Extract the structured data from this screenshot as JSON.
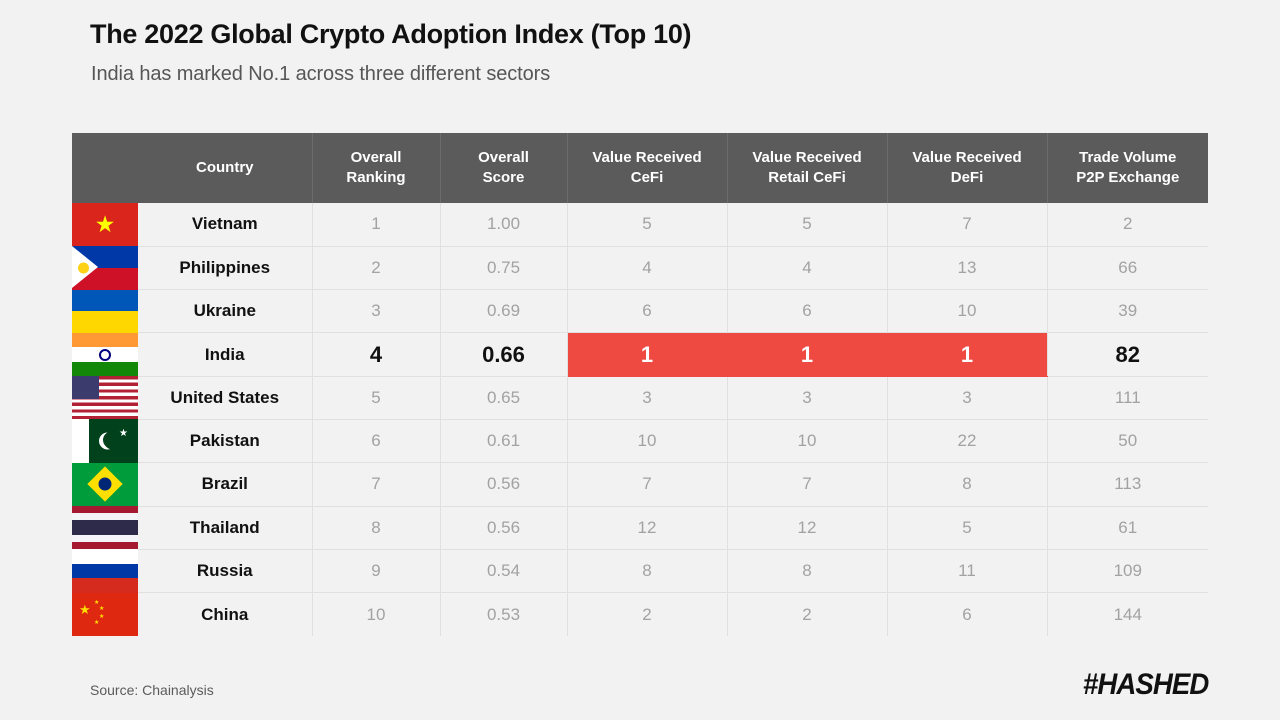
{
  "title": "The 2022 Global Crypto Adoption Index (Top 10)",
  "subtitle": "India has marked No.1 across three different sectors",
  "source": "Source: Chainalysis",
  "logo": "#HASHED",
  "colors": {
    "background": "#f2f2f2",
    "header_bg": "#5b5b5b",
    "highlight_red": "#ef4a42",
    "cell_bg": "#f2f2f2",
    "muted_text": "#a2a2a2",
    "dark_text": "#111111"
  },
  "chart_data": {
    "type": "table",
    "title": "The 2022 Global Crypto Adoption Index (Top 10)",
    "subtitle": "India has marked No.1 across three different sectors",
    "columns": [
      "Country",
      "Overall Ranking",
      "Overall Score",
      "Value Received CeFi",
      "Value Received Retail CeFi",
      "Value Received DeFi",
      "Trade Volume P2P Exchange"
    ],
    "column_headers": [
      {
        "line1": "Country",
        "line2": ""
      },
      {
        "line1": "Overall",
        "line2": "Ranking"
      },
      {
        "line1": "Overall",
        "line2": "Score"
      },
      {
        "line1": "Value Received",
        "line2": "CeFi"
      },
      {
        "line1": "Value Received",
        "line2": "Retail CeFi"
      },
      {
        "line1": "Value Received",
        "line2": "DeFi"
      },
      {
        "line1": "Trade Volume",
        "line2": "P2P Exchange"
      }
    ],
    "rows": [
      {
        "flag": "vn",
        "country": "Vietnam",
        "ranking": "1",
        "score": "1.00",
        "cefi": "5",
        "retail_cefi": "5",
        "defi": "7",
        "p2p": "2",
        "highlight": false
      },
      {
        "flag": "ph",
        "country": "Philippines",
        "ranking": "2",
        "score": "0.75",
        "cefi": "4",
        "retail_cefi": "4",
        "defi": "13",
        "p2p": "66",
        "highlight": false
      },
      {
        "flag": "ua",
        "country": "Ukraine",
        "ranking": "3",
        "score": "0.69",
        "cefi": "6",
        "retail_cefi": "6",
        "defi": "10",
        "p2p": "39",
        "highlight": false
      },
      {
        "flag": "in",
        "country": "India",
        "ranking": "4",
        "score": "0.66",
        "cefi": "1",
        "retail_cefi": "1",
        "defi": "1",
        "p2p": "82",
        "highlight": true
      },
      {
        "flag": "us",
        "country": "United States",
        "ranking": "5",
        "score": "0.65",
        "cefi": "3",
        "retail_cefi": "3",
        "defi": "3",
        "p2p": "111",
        "highlight": false
      },
      {
        "flag": "pk",
        "country": "Pakistan",
        "ranking": "6",
        "score": "0.61",
        "cefi": "10",
        "retail_cefi": "10",
        "defi": "22",
        "p2p": "50",
        "highlight": false
      },
      {
        "flag": "br",
        "country": "Brazil",
        "ranking": "7",
        "score": "0.56",
        "cefi": "7",
        "retail_cefi": "7",
        "defi": "8",
        "p2p": "113",
        "highlight": false
      },
      {
        "flag": "th",
        "country": "Thailand",
        "ranking": "8",
        "score": "0.56",
        "cefi": "12",
        "retail_cefi": "12",
        "defi": "5",
        "p2p": "61",
        "highlight": false
      },
      {
        "flag": "ru",
        "country": "Russia",
        "ranking": "9",
        "score": "0.54",
        "cefi": "8",
        "retail_cefi": "8",
        "defi": "11",
        "p2p": "109",
        "highlight": false
      },
      {
        "flag": "cn",
        "country": "China",
        "ranking": "10",
        "score": "0.53",
        "cefi": "2",
        "retail_cefi": "2",
        "defi": "6",
        "p2p": "144",
        "highlight": false
      }
    ],
    "highlighted_cells": [
      "cefi",
      "retail_cefi",
      "defi"
    ],
    "highlighted_row": "India",
    "legend": [],
    "grid": true
  }
}
